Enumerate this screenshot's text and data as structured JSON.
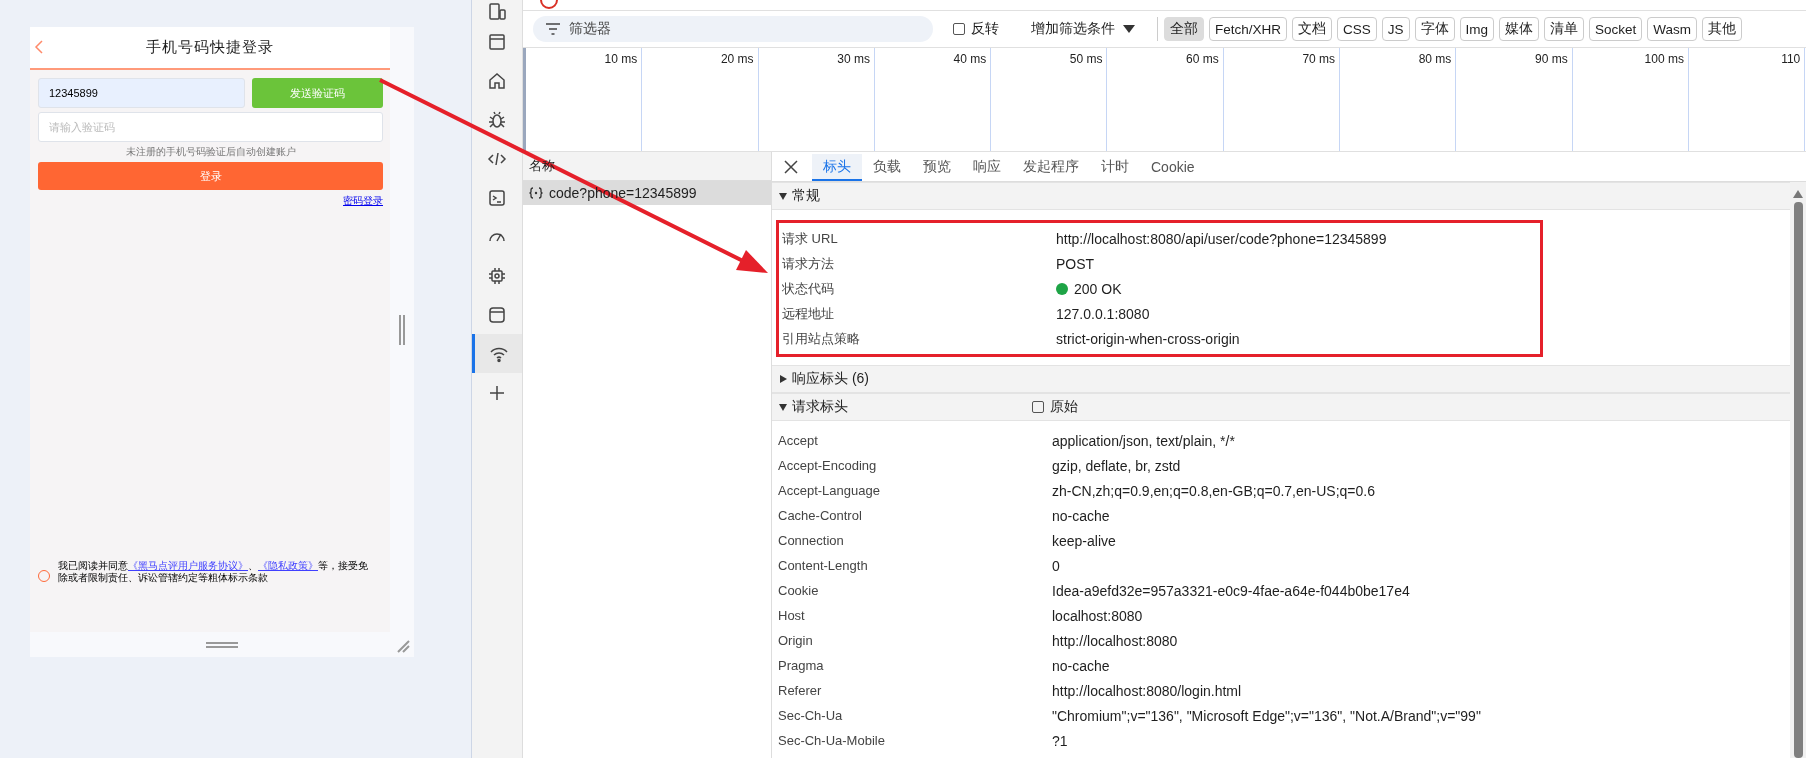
{
  "phone": {
    "title": "手机号码快捷登录",
    "phone_value": "12345899",
    "send_button": "发送验证码",
    "code_placeholder": "请输入验证码",
    "hint": "未注册的手机号码验证后自动创建账户",
    "login_button": "登录",
    "password_link": "密码登录",
    "agreement": {
      "checked": false,
      "parts": [
        {
          "kind": "text",
          "text": "我已阅读并同意"
        },
        {
          "kind": "link",
          "text": "《黑马点评用户服务协议》"
        },
        {
          "kind": "text",
          "text": "、"
        },
        {
          "kind": "link",
          "text": "《隐私政策》"
        },
        {
          "kind": "text",
          "text": "等，接受免除或者限制责任、诉讼管辖约定等粗体标示条款"
        }
      ]
    }
  },
  "devtools": {
    "sidebar": [
      {
        "selected": false
      },
      {
        "selected": false
      },
      {
        "selected": false
      },
      {
        "selected": false
      },
      {
        "selected": false
      },
      {
        "selected": false
      },
      {
        "selected": false
      },
      {
        "selected": false
      },
      {
        "selected": false
      },
      {
        "selected": true
      },
      {
        "selected": false
      }
    ],
    "filter": {
      "placeholder": "筛选器",
      "invert": {
        "label": "反转",
        "checked": false
      },
      "more_filters": "增加筛选条件",
      "types": [
        {
          "label": "全部",
          "selected": true
        },
        {
          "label": "Fetch/XHR",
          "selected": false
        },
        {
          "label": "文档",
          "selected": false
        },
        {
          "label": "CSS",
          "selected": false
        },
        {
          "label": "JS",
          "selected": false
        },
        {
          "label": "字体",
          "selected": false
        },
        {
          "label": "Img",
          "selected": false
        },
        {
          "label": "媒体",
          "selected": false
        },
        {
          "label": "清单",
          "selected": false
        },
        {
          "label": "Socket",
          "selected": false
        },
        {
          "label": "Wasm",
          "selected": false
        },
        {
          "label": "其他",
          "selected": false
        }
      ]
    },
    "timeline": {
      "ticks": [
        "10 ms",
        "20 ms",
        "30 ms",
        "40 ms",
        "50 ms",
        "60 ms",
        "70 ms",
        "80 ms",
        "90 ms",
        "100 ms",
        "110"
      ]
    },
    "requests": {
      "header": "名称",
      "items": [
        {
          "name": "code?phone=12345899",
          "selected": true
        }
      ]
    },
    "detail_tabs": [
      {
        "label": "标头",
        "selected": true
      },
      {
        "label": "负载",
        "selected": false
      },
      {
        "label": "预览",
        "selected": false
      },
      {
        "label": "响应",
        "selected": false
      },
      {
        "label": "发起程序",
        "selected": false
      },
      {
        "label": "计时",
        "selected": false
      },
      {
        "label": "Cookie",
        "selected": false
      }
    ],
    "general": {
      "title": "常规",
      "expanded": true,
      "rows": [
        {
          "name": "请求 URL",
          "value": "http://localhost:8080/api/user/code?phone=12345899"
        },
        {
          "name": "请求方法",
          "value": "POST"
        },
        {
          "name": "状态代码",
          "value": "200 OK",
          "kind": "status",
          "color": "#1ea446"
        },
        {
          "name": "远程地址",
          "value": "127.0.0.1:8080"
        },
        {
          "name": "引用站点策略",
          "value": "strict-origin-when-cross-origin"
        }
      ]
    },
    "response_headers": {
      "title": "响应标头 (6)",
      "expanded": false
    },
    "request_headers": {
      "title": "请求标头",
      "expanded": true,
      "raw": {
        "label": "原始",
        "checked": false
      },
      "rows": [
        {
          "name": "Accept",
          "value": "application/json, text/plain, */*"
        },
        {
          "name": "Accept-Encoding",
          "value": "gzip, deflate, br, zstd"
        },
        {
          "name": "Accept-Language",
          "value": "zh-CN,zh;q=0.9,en;q=0.8,en-GB;q=0.7,en-US;q=0.6"
        },
        {
          "name": "Cache-Control",
          "value": "no-cache"
        },
        {
          "name": "Connection",
          "value": "keep-alive"
        },
        {
          "name": "Content-Length",
          "value": "0"
        },
        {
          "name": "Cookie",
          "value": "Idea-a9efd32e=957a3321-e0c9-4fae-a64e-f044b0be17e4"
        },
        {
          "name": "Host",
          "value": "localhost:8080"
        },
        {
          "name": "Origin",
          "value": "http://localhost:8080"
        },
        {
          "name": "Pragma",
          "value": "no-cache"
        },
        {
          "name": "Referer",
          "value": "http://localhost:8080/login.html"
        },
        {
          "name": "Sec-Ch-Ua",
          "value": "\"Chromium\";v=\"136\", \"Microsoft Edge\";v=\"136\", \"Not.A/Brand\";v=\"99\""
        },
        {
          "name": "Sec-Ch-Ua-Mobile",
          "value": "?1"
        }
      ]
    }
  }
}
